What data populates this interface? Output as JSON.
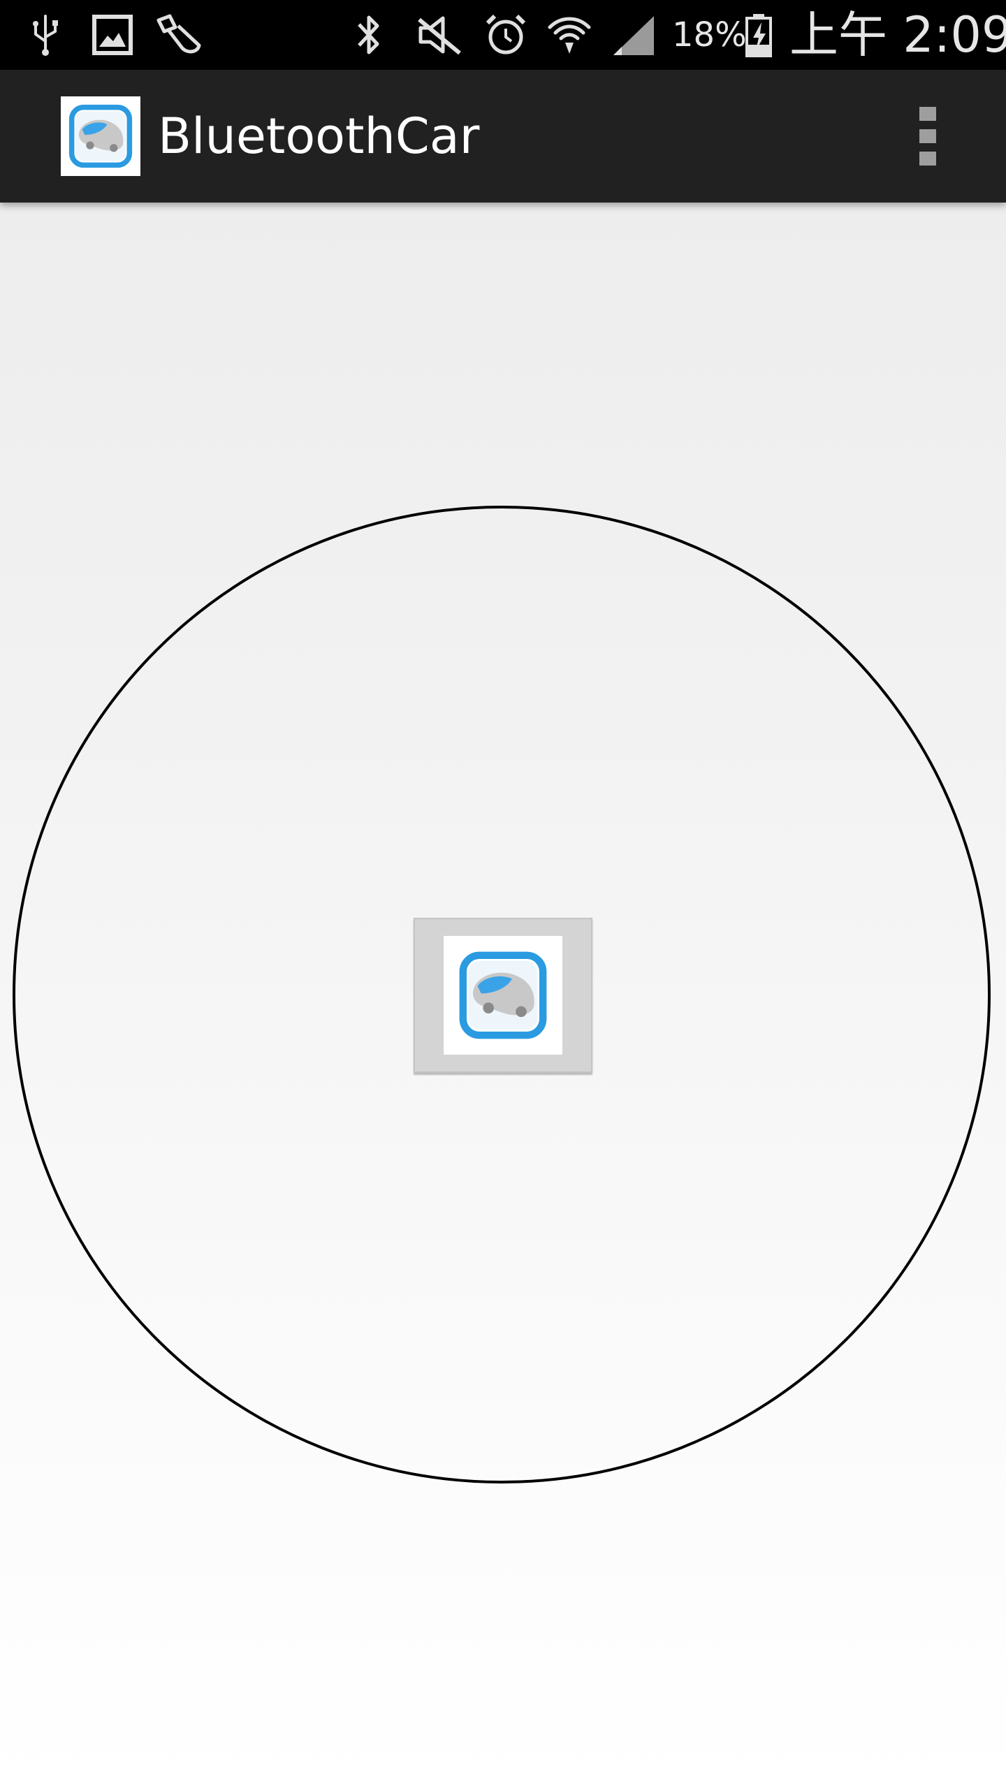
{
  "status_bar": {
    "icons": [
      "usb-icon",
      "gallery-icon",
      "cleaner-icon",
      "bluetooth-icon",
      "mute-icon",
      "alarm-icon",
      "wifi-icon",
      "signal-icon",
      "battery-charging-icon"
    ],
    "battery_percent": "18%",
    "time": "上午 2:09"
  },
  "action_bar": {
    "app_icon": "bluetooth-car-logo-icon",
    "title": "BluetoothCar",
    "overflow_icon": "overflow-menu-icon"
  },
  "joystick": {
    "ring_color": "#000000",
    "knob_icon": "bluetooth-car-logo-icon"
  },
  "colors": {
    "status_bar_bg": "#000000",
    "action_bar_bg": "#212121",
    "icon_blue": "#2a9be0",
    "knob_bg": "#d4d4d4"
  }
}
